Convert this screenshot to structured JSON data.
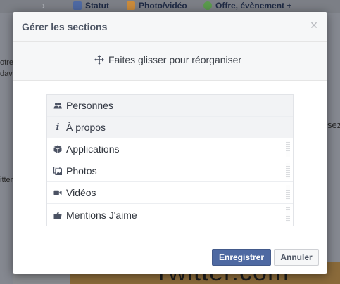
{
  "background": {
    "composer": {
      "status_label": "Statut",
      "photo_video_label": "Photo/vidéo",
      "offer_event_label": "Offre, évènement +"
    },
    "fragments": {
      "left_1": "otre",
      "left_2": "dav",
      "left_3": "itter",
      "right_1": "sez"
    },
    "banner_text": "Twitter.com"
  },
  "dialog": {
    "title": "Gérer les sections",
    "close_glyph": "×",
    "hint": "Faites glisser pour réorganiser",
    "sections": [
      {
        "label": "Personnes",
        "icon": "people-icon"
      },
      {
        "label": "À propos",
        "icon": "info-icon"
      },
      {
        "label": "Applications",
        "icon": "cube-icon"
      },
      {
        "label": "Photos",
        "icon": "photos-icon"
      },
      {
        "label": "Vidéos",
        "icon": "video-camera-icon"
      },
      {
        "label": "Mentions J'aime",
        "icon": "thumbs-up-icon"
      }
    ],
    "save_label": "Enregistrer",
    "cancel_label": "Annuler"
  },
  "colors": {
    "primary_button": "#4e69a2",
    "header_background": "#f6f7f8",
    "overlay": "#8a8c90"
  }
}
